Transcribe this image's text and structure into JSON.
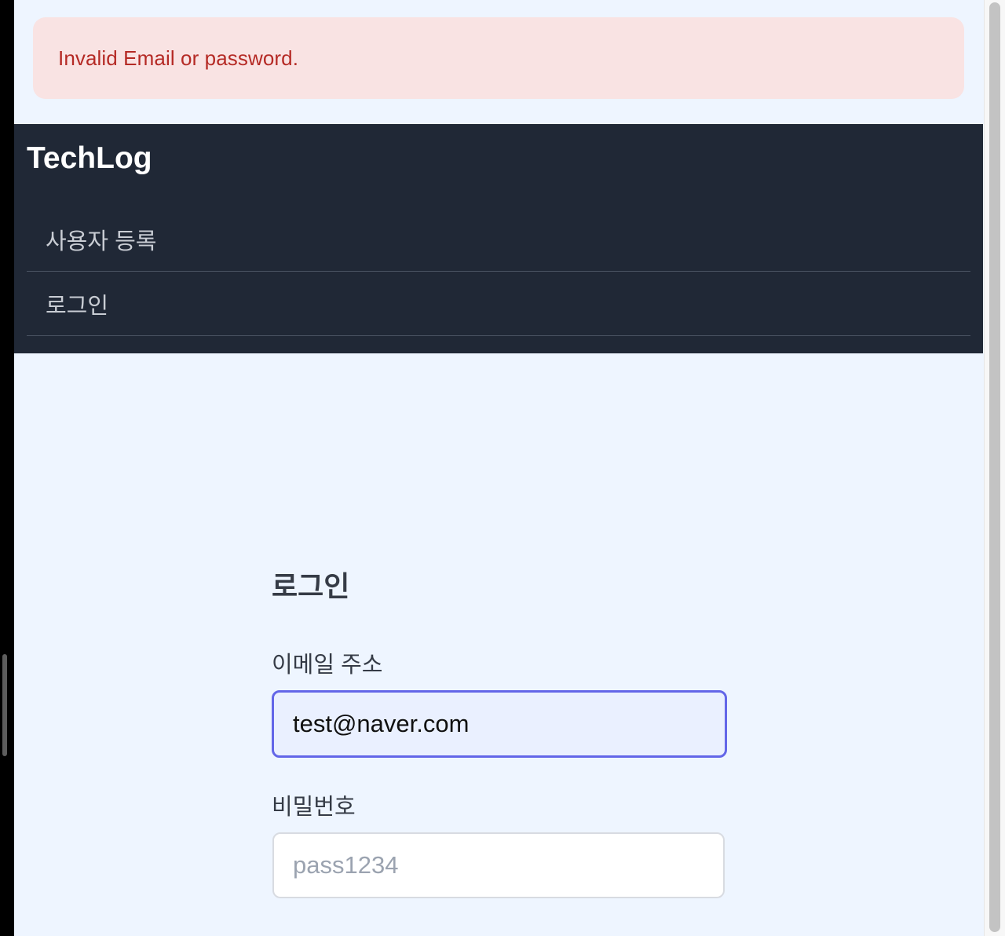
{
  "alert": {
    "message": "Invalid Email or password."
  },
  "navbar": {
    "brand": "TechLog",
    "items": [
      {
        "label": "사용자 등록"
      },
      {
        "label": "로그인"
      }
    ]
  },
  "login_form": {
    "title": "로그인",
    "email": {
      "label": "이메일 주소",
      "value": "test@naver.com"
    },
    "password": {
      "label": "비밀번호",
      "placeholder": "pass1234"
    }
  }
}
